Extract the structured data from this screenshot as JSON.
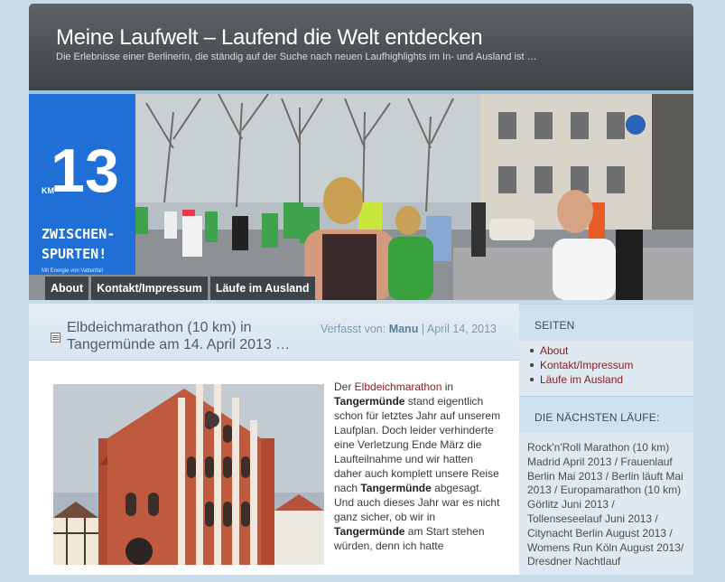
{
  "header": {
    "title": "Meine Laufwelt – Laufend die Welt entdecken",
    "description": "Die Erlebnisse einer Berlinerin, die ständig auf der Suche nach neuen Laufhighlights im In- und Ausland ist …"
  },
  "banner": {
    "km_marker": "13",
    "km_unit": "KM",
    "sign_line1": "ZWISCHEN-",
    "sign_line2": "SPURTEN!",
    "sign_small": "Mit Energie von Vattenfall"
  },
  "nav": {
    "items": [
      {
        "label": "About"
      },
      {
        "label": "Kontakt/Impressum"
      },
      {
        "label": "Läufe im Ausland"
      }
    ]
  },
  "post": {
    "title": "Elbdeichmarathon (10 km) in Tangermünde am 14. April 2013 …",
    "meta_prefix": "Verfasst von:",
    "author": "Manu",
    "separator": "|",
    "date": "April 14, 2013",
    "text": {
      "t1": "Der ",
      "link1": "Elbdeichmarathon",
      "t2": " in ",
      "b1": "Tangermünde",
      "t3": " stand eigentlich schon für letztes Jahr auf unserem Laufplan. Doch leider verhinderte eine Verletzung Ende März die Laufteilnahme und wir hatten daher auch komplett unsere Reise nach ",
      "b2": "Tangermünde",
      "t4": " abgesagt. Und auch dieses Jahr war es nicht ganz sicher, ob wir in ",
      "b3": "Tangermünde",
      "t5": " am Start stehen würden, denn ich hatte"
    }
  },
  "sidebar": {
    "pages_heading": "SEITEN",
    "pages": [
      {
        "label": "About"
      },
      {
        "label": "Kontakt/Impressum"
      },
      {
        "label": "Läufe im Ausland"
      }
    ],
    "next_heading": "DIE NÄCHSTEN LÄUFE:",
    "next_text": "Rock'n'Roll Marathon (10 km) Madrid April 2013 / Frauenlauf Berlin Mai 2013 / Berlin läuft Mai 2013 / Europamarathon (10 km) Görlitz Juni 2013 / Tollenseseelauf Juni 2013 / Citynacht Berlin August 2013 / Womens Run Köln August 2013/ Dresdner Nachtlauf"
  },
  "colors": {
    "header": "#4a4f53",
    "link": "#8b1a1a",
    "accent": "#9ec3d2",
    "sidebar": "#dfe9f1"
  }
}
